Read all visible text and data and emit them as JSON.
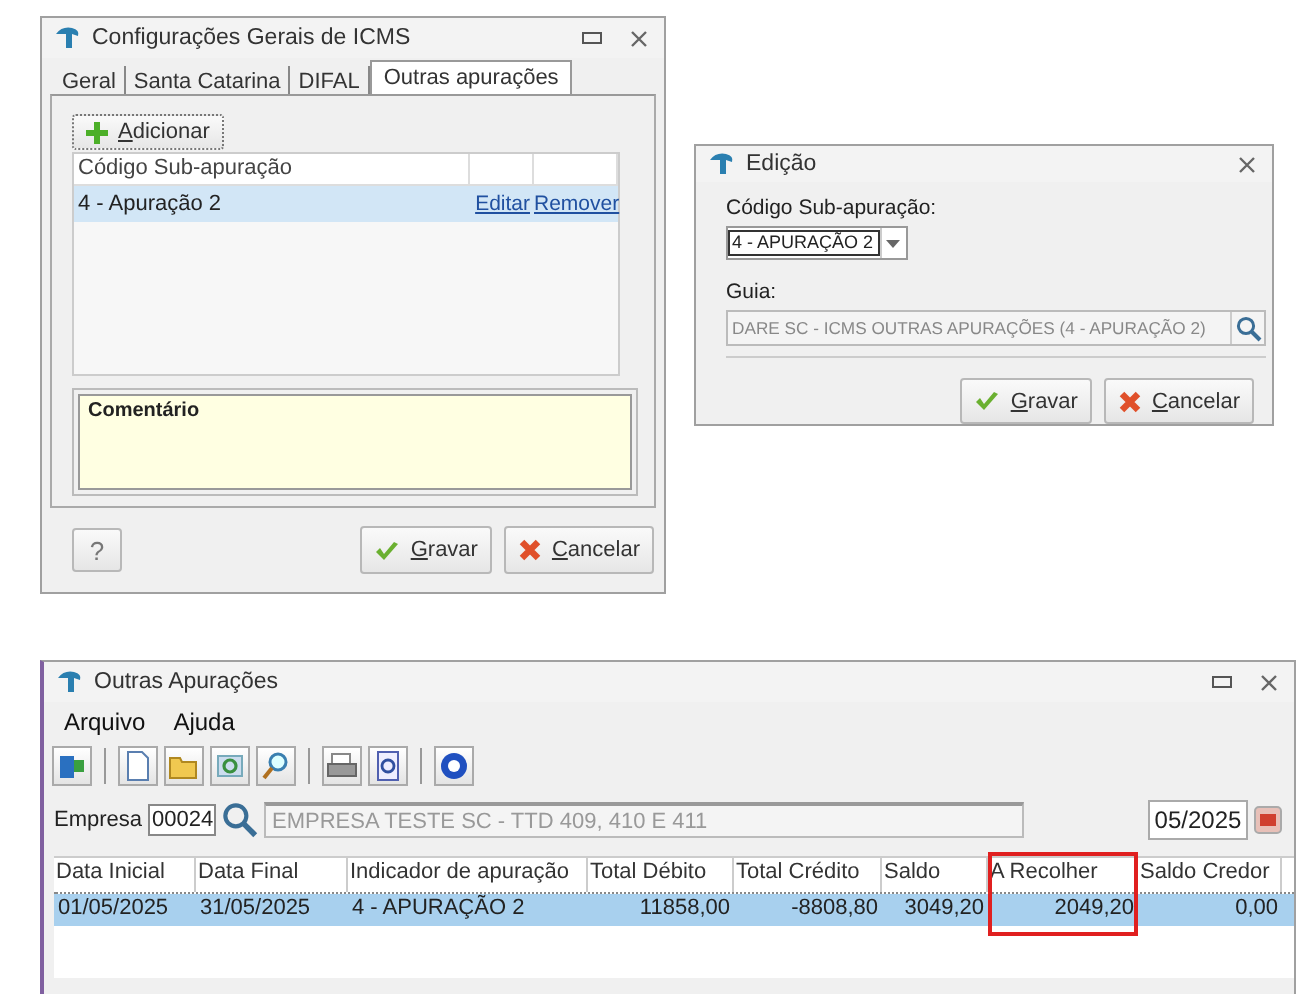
{
  "config_window": {
    "title": "Configurações Gerais de ICMS",
    "tabs": [
      {
        "label": "Geral",
        "selected": false
      },
      {
        "label": "Santa Catarina",
        "selected": false
      },
      {
        "label": "DIFAL",
        "selected": false
      },
      {
        "label": "Outras apurações",
        "selected": true
      }
    ],
    "add_button": "Adicionar",
    "table": {
      "columns": [
        "Código Sub-apuração"
      ],
      "rows": [
        {
          "code": "4 - Apuração 2",
          "edit": "Editar",
          "remove": "Remover",
          "selected": true
        }
      ]
    },
    "comment_label": "Comentário",
    "help_button": "?",
    "buttons": [
      "Gravar",
      "Cancelar"
    ]
  },
  "edit_window": {
    "title": "Edição",
    "code_label": "Código Sub-apuração:",
    "code_value": "4 - APURAÇÃO 2",
    "guide_label": "Guia:",
    "guide_value": "DARE SC - ICMS OUTRAS APURAÇÕES (4 - APURAÇÃO 2)",
    "buttons": [
      "Gravar",
      "Cancelar"
    ]
  },
  "main_window": {
    "title": "Outras Apurações",
    "menu": [
      "Arquivo",
      "Ajuda"
    ],
    "company_label": "Empresa",
    "company_code": "00024",
    "company_name": "EMPRESA TESTE SC - TTD 409, 410 E 411",
    "period": "05/2025",
    "table": {
      "columns": [
        {
          "label": "Data Inicial",
          "highlighted": false
        },
        {
          "label": "Data Final",
          "highlighted": false
        },
        {
          "label": "Indicador de apuração",
          "highlighted": false
        },
        {
          "label": "Total Débito",
          "highlighted": false
        },
        {
          "label": "Total Crédito",
          "highlighted": false
        },
        {
          "label": "Saldo",
          "highlighted": false
        },
        {
          "label": "A Recolher",
          "highlighted": true
        },
        {
          "label": "Saldo Credor",
          "highlighted": false
        }
      ],
      "rows": [
        {
          "cells": [
            "01/05/2025",
            "31/05/2025",
            "4 - APURAÇÃO 2",
            "11858,00",
            "-8808,80",
            "3049,20",
            "2049,20",
            "0,00"
          ],
          "selected": true
        }
      ]
    }
  }
}
